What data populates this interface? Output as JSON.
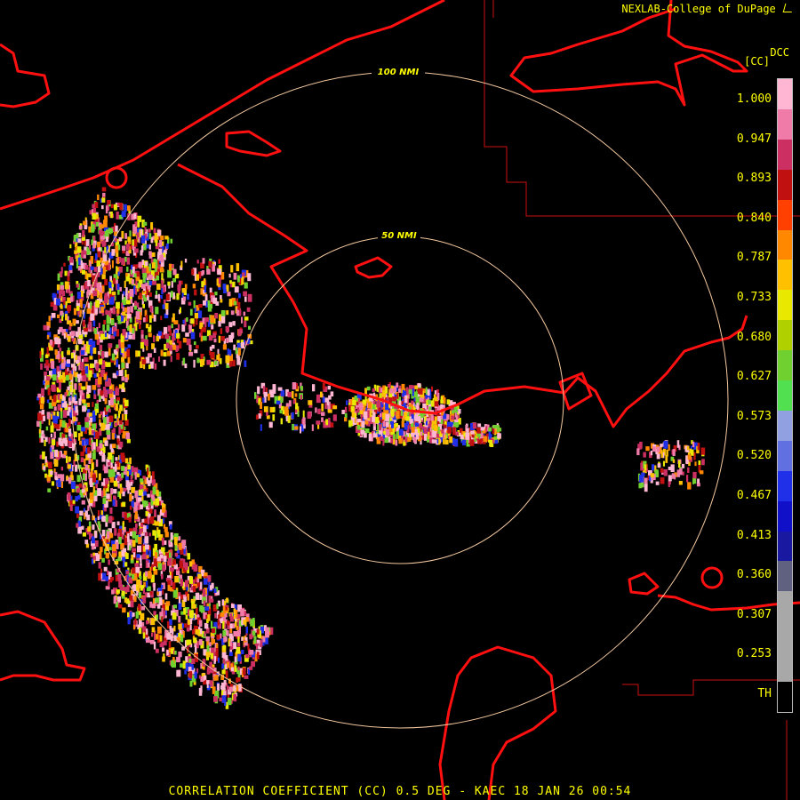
{
  "header": {
    "credit": "NEXLAB-College of DuPage",
    "credit_icon": "dupage-mark-icon",
    "product_code": "DCC",
    "units": "[CC]"
  },
  "rings": {
    "inner_label": "50 NMI",
    "outer_label": "100 NMI"
  },
  "legend": {
    "ticks": [
      "1.000",
      "0.947",
      "0.893",
      "0.840",
      "0.787",
      "0.733",
      "0.680",
      "0.627",
      "0.573",
      "0.520",
      "0.467",
      "0.413",
      "0.360",
      "0.307",
      "0.253",
      "TH"
    ],
    "colors": [
      "#ffb6d2",
      "#f07aa8",
      "#cc2f62",
      "#c01010",
      "#ff4000",
      "#ff8800",
      "#ffc000",
      "#e8e800",
      "#b0d000",
      "#70d030",
      "#50e050",
      "#90a0e0",
      "#6070e0",
      "#2030e8",
      "#1010c8",
      "#1818a0",
      "#606080",
      "#a8a8a8",
      "#a8a8a8",
      "#a8a8a8",
      "#000000"
    ]
  },
  "footer": {
    "caption": "CORRELATION COEFFICIENT (CC) 0.5 DEG - KAEC 18 JAN 26 00:54"
  }
}
